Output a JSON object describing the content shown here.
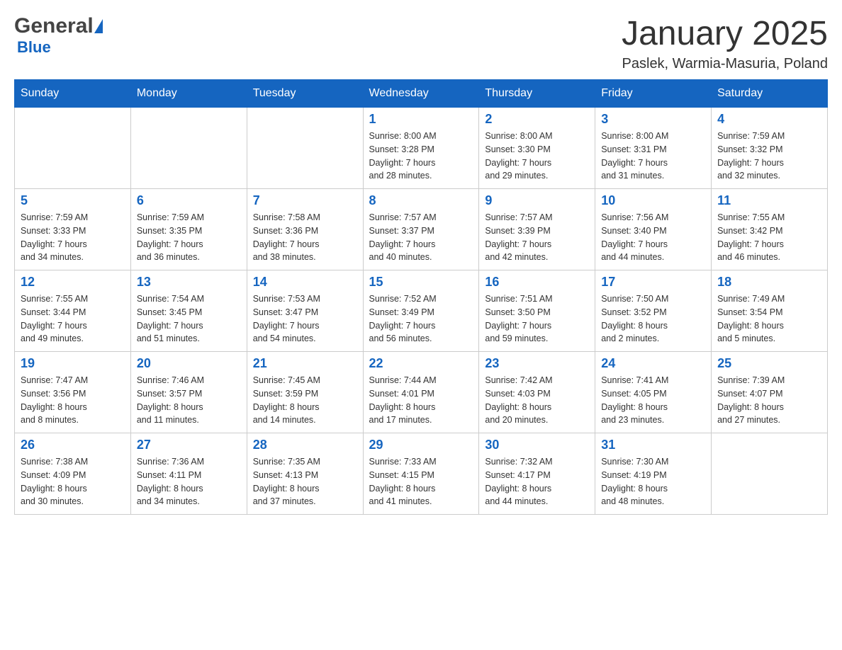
{
  "header": {
    "logo_general": "General",
    "logo_blue": "Blue",
    "month_title": "January 2025",
    "location": "Paslek, Warmia-Masuria, Poland"
  },
  "days_of_week": [
    "Sunday",
    "Monday",
    "Tuesday",
    "Wednesday",
    "Thursday",
    "Friday",
    "Saturday"
  ],
  "weeks": [
    [
      {
        "day": "",
        "info": ""
      },
      {
        "day": "",
        "info": ""
      },
      {
        "day": "",
        "info": ""
      },
      {
        "day": "1",
        "info": "Sunrise: 8:00 AM\nSunset: 3:28 PM\nDaylight: 7 hours\nand 28 minutes."
      },
      {
        "day": "2",
        "info": "Sunrise: 8:00 AM\nSunset: 3:30 PM\nDaylight: 7 hours\nand 29 minutes."
      },
      {
        "day": "3",
        "info": "Sunrise: 8:00 AM\nSunset: 3:31 PM\nDaylight: 7 hours\nand 31 minutes."
      },
      {
        "day": "4",
        "info": "Sunrise: 7:59 AM\nSunset: 3:32 PM\nDaylight: 7 hours\nand 32 minutes."
      }
    ],
    [
      {
        "day": "5",
        "info": "Sunrise: 7:59 AM\nSunset: 3:33 PM\nDaylight: 7 hours\nand 34 minutes."
      },
      {
        "day": "6",
        "info": "Sunrise: 7:59 AM\nSunset: 3:35 PM\nDaylight: 7 hours\nand 36 minutes."
      },
      {
        "day": "7",
        "info": "Sunrise: 7:58 AM\nSunset: 3:36 PM\nDaylight: 7 hours\nand 38 minutes."
      },
      {
        "day": "8",
        "info": "Sunrise: 7:57 AM\nSunset: 3:37 PM\nDaylight: 7 hours\nand 40 minutes."
      },
      {
        "day": "9",
        "info": "Sunrise: 7:57 AM\nSunset: 3:39 PM\nDaylight: 7 hours\nand 42 minutes."
      },
      {
        "day": "10",
        "info": "Sunrise: 7:56 AM\nSunset: 3:40 PM\nDaylight: 7 hours\nand 44 minutes."
      },
      {
        "day": "11",
        "info": "Sunrise: 7:55 AM\nSunset: 3:42 PM\nDaylight: 7 hours\nand 46 minutes."
      }
    ],
    [
      {
        "day": "12",
        "info": "Sunrise: 7:55 AM\nSunset: 3:44 PM\nDaylight: 7 hours\nand 49 minutes."
      },
      {
        "day": "13",
        "info": "Sunrise: 7:54 AM\nSunset: 3:45 PM\nDaylight: 7 hours\nand 51 minutes."
      },
      {
        "day": "14",
        "info": "Sunrise: 7:53 AM\nSunset: 3:47 PM\nDaylight: 7 hours\nand 54 minutes."
      },
      {
        "day": "15",
        "info": "Sunrise: 7:52 AM\nSunset: 3:49 PM\nDaylight: 7 hours\nand 56 minutes."
      },
      {
        "day": "16",
        "info": "Sunrise: 7:51 AM\nSunset: 3:50 PM\nDaylight: 7 hours\nand 59 minutes."
      },
      {
        "day": "17",
        "info": "Sunrise: 7:50 AM\nSunset: 3:52 PM\nDaylight: 8 hours\nand 2 minutes."
      },
      {
        "day": "18",
        "info": "Sunrise: 7:49 AM\nSunset: 3:54 PM\nDaylight: 8 hours\nand 5 minutes."
      }
    ],
    [
      {
        "day": "19",
        "info": "Sunrise: 7:47 AM\nSunset: 3:56 PM\nDaylight: 8 hours\nand 8 minutes."
      },
      {
        "day": "20",
        "info": "Sunrise: 7:46 AM\nSunset: 3:57 PM\nDaylight: 8 hours\nand 11 minutes."
      },
      {
        "day": "21",
        "info": "Sunrise: 7:45 AM\nSunset: 3:59 PM\nDaylight: 8 hours\nand 14 minutes."
      },
      {
        "day": "22",
        "info": "Sunrise: 7:44 AM\nSunset: 4:01 PM\nDaylight: 8 hours\nand 17 minutes."
      },
      {
        "day": "23",
        "info": "Sunrise: 7:42 AM\nSunset: 4:03 PM\nDaylight: 8 hours\nand 20 minutes."
      },
      {
        "day": "24",
        "info": "Sunrise: 7:41 AM\nSunset: 4:05 PM\nDaylight: 8 hours\nand 23 minutes."
      },
      {
        "day": "25",
        "info": "Sunrise: 7:39 AM\nSunset: 4:07 PM\nDaylight: 8 hours\nand 27 minutes."
      }
    ],
    [
      {
        "day": "26",
        "info": "Sunrise: 7:38 AM\nSunset: 4:09 PM\nDaylight: 8 hours\nand 30 minutes."
      },
      {
        "day": "27",
        "info": "Sunrise: 7:36 AM\nSunset: 4:11 PM\nDaylight: 8 hours\nand 34 minutes."
      },
      {
        "day": "28",
        "info": "Sunrise: 7:35 AM\nSunset: 4:13 PM\nDaylight: 8 hours\nand 37 minutes."
      },
      {
        "day": "29",
        "info": "Sunrise: 7:33 AM\nSunset: 4:15 PM\nDaylight: 8 hours\nand 41 minutes."
      },
      {
        "day": "30",
        "info": "Sunrise: 7:32 AM\nSunset: 4:17 PM\nDaylight: 8 hours\nand 44 minutes."
      },
      {
        "day": "31",
        "info": "Sunrise: 7:30 AM\nSunset: 4:19 PM\nDaylight: 8 hours\nand 48 minutes."
      },
      {
        "day": "",
        "info": ""
      }
    ]
  ],
  "colors": {
    "header_bg": "#1565c0",
    "header_text": "#ffffff",
    "day_number": "#1565c0",
    "border": "#cccccc"
  }
}
